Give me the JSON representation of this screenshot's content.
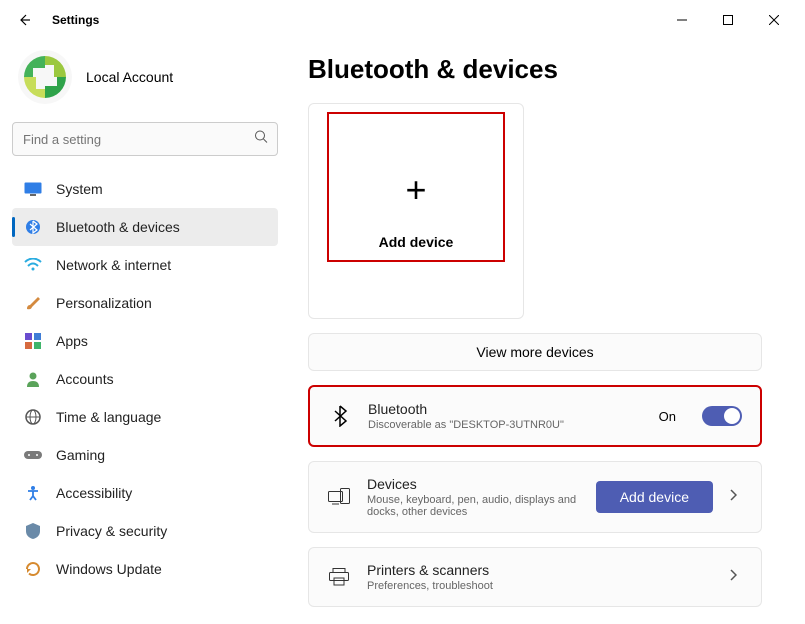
{
  "window": {
    "title": "Settings"
  },
  "profile": {
    "name": "Local Account"
  },
  "search": {
    "placeholder": "Find a setting"
  },
  "sidebar": {
    "items": [
      {
        "label": "System"
      },
      {
        "label": "Bluetooth & devices"
      },
      {
        "label": "Network & internet"
      },
      {
        "label": "Personalization"
      },
      {
        "label": "Apps"
      },
      {
        "label": "Accounts"
      },
      {
        "label": "Time & language"
      },
      {
        "label": "Gaming"
      },
      {
        "label": "Accessibility"
      },
      {
        "label": "Privacy & security"
      },
      {
        "label": "Windows Update"
      }
    ]
  },
  "page": {
    "title": "Bluetooth & devices",
    "add_card_label": "Add device",
    "view_more": "View more devices",
    "bluetooth": {
      "title": "Bluetooth",
      "sub": "Discoverable as \"DESKTOP-3UTNR0U\"",
      "state": "On"
    },
    "devices": {
      "title": "Devices",
      "sub": "Mouse, keyboard, pen, audio, displays and docks, other devices",
      "button": "Add device"
    },
    "printers": {
      "title": "Printers & scanners",
      "sub": "Preferences, troubleshoot"
    }
  }
}
